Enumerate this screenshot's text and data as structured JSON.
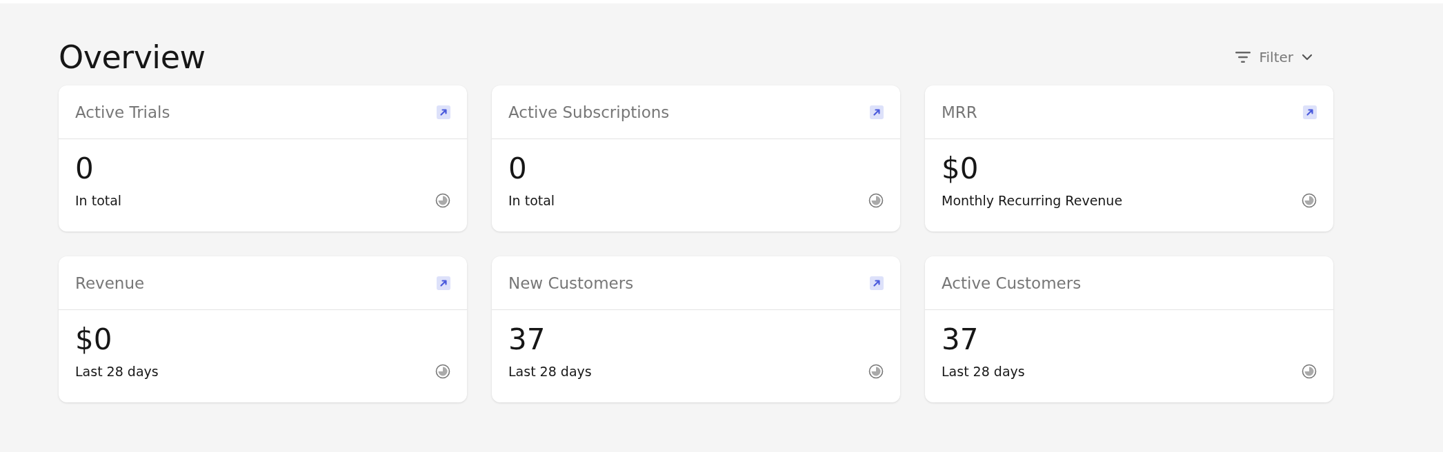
{
  "title": "Overview",
  "filter": {
    "label": "Filter"
  },
  "cards": [
    {
      "title": "Active Trials",
      "linked": true,
      "value": "0",
      "caption": "In total"
    },
    {
      "title": "Active Subscriptions",
      "linked": true,
      "value": "0",
      "caption": "In total"
    },
    {
      "title": "MRR",
      "linked": true,
      "value": "$0",
      "caption": "Monthly Recurring Revenue"
    },
    {
      "title": "Revenue",
      "linked": true,
      "value": "$0",
      "caption": "Last 28 days"
    },
    {
      "title": "New Customers",
      "linked": true,
      "value": "37",
      "caption": "Last 28 days"
    },
    {
      "title": "Active Customers",
      "linked": false,
      "value": "37",
      "caption": "Last 28 days"
    }
  ]
}
